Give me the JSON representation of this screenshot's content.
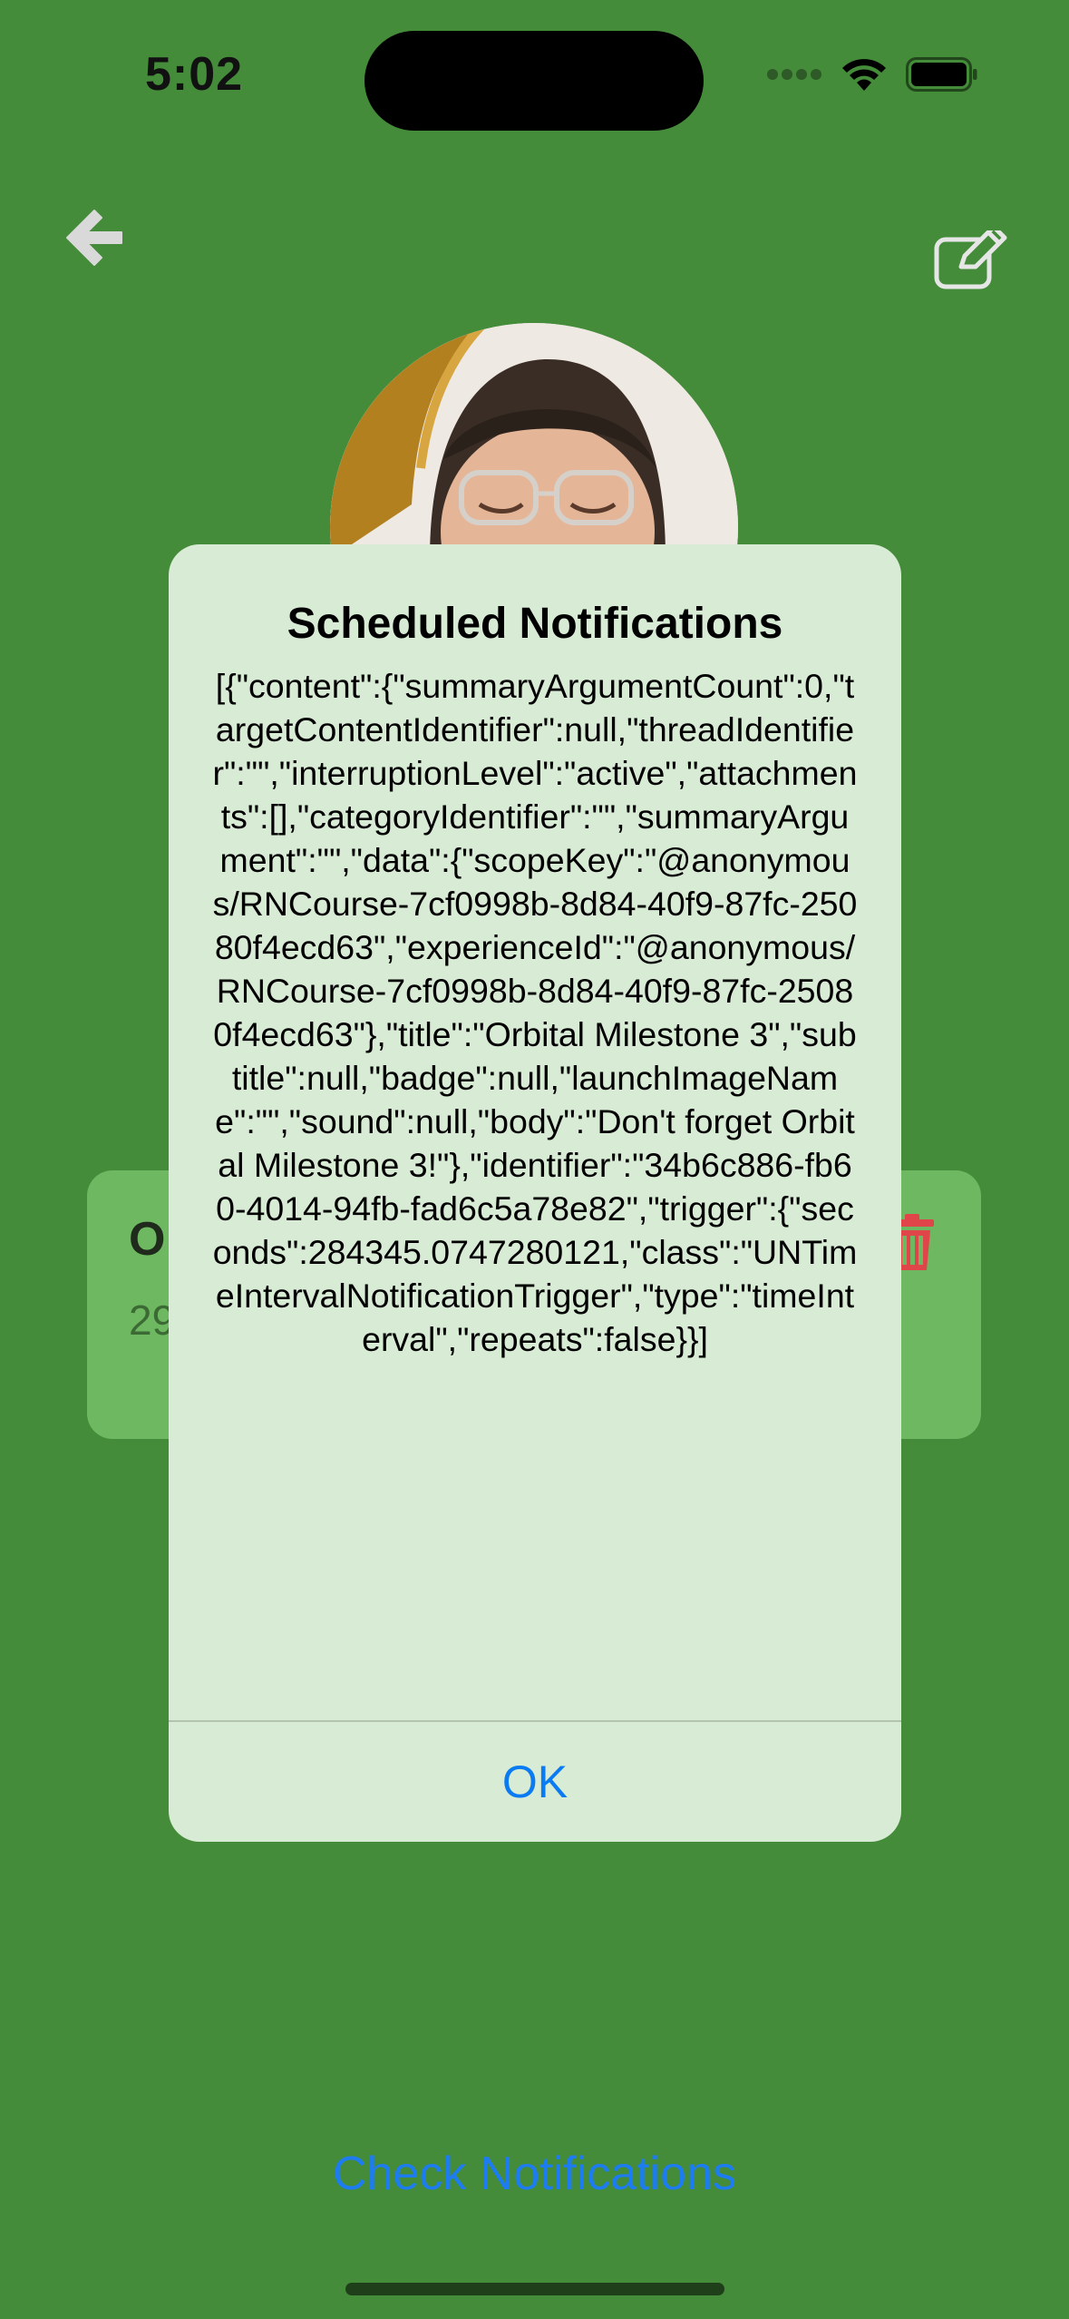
{
  "status_bar": {
    "time": "5:02"
  },
  "header": {
    "back_icon": "arrow-left-icon",
    "edit_icon": "pencil-square-icon"
  },
  "card": {
    "title": "O",
    "subtitle": "29",
    "delete_icon": "trash-icon",
    "delete_color": "#e0454a"
  },
  "footer": {
    "check_label": "Check Notifications"
  },
  "alert": {
    "title": "Scheduled Notifications",
    "message": "[{\"content\":{\"summaryArgumentCount\":0,\"targetContentIdentifier\":null,\"threadIdentifier\":\"\",\"interruptionLevel\":\"active\",\"attachments\":[],\"categoryIdentifier\":\"\",\"summaryArgument\":\"\",\"data\":{\"scopeKey\":\"@anonymous/RNCourse-7cf0998b-8d84-40f9-87fc-25080f4ecd63\",\"experienceId\":\"@anonymous/RNCourse-7cf0998b-8d84-40f9-87fc-25080f4ecd63\"},\"title\":\"Orbital Milestone 3\",\"subtitle\":null,\"badge\":null,\"launchImageName\":\"\",\"sound\":null,\"body\":\"Don't forget Orbital Milestone 3!\"},\"identifier\":\"34b6c886-fb60-4014-94fb-fad6c5a78e82\",\"trigger\":{\"seconds\":284345.0747280121,\"class\":\"UNTimeIntervalNotificationTrigger\",\"type\":\"timeInterval\",\"repeats\":false}}]",
    "ok_label": "OK"
  },
  "colors": {
    "background": "#448c39",
    "card": "#6db860",
    "alert_background": "#d8ebd4",
    "accent": "#0a7bf2"
  }
}
